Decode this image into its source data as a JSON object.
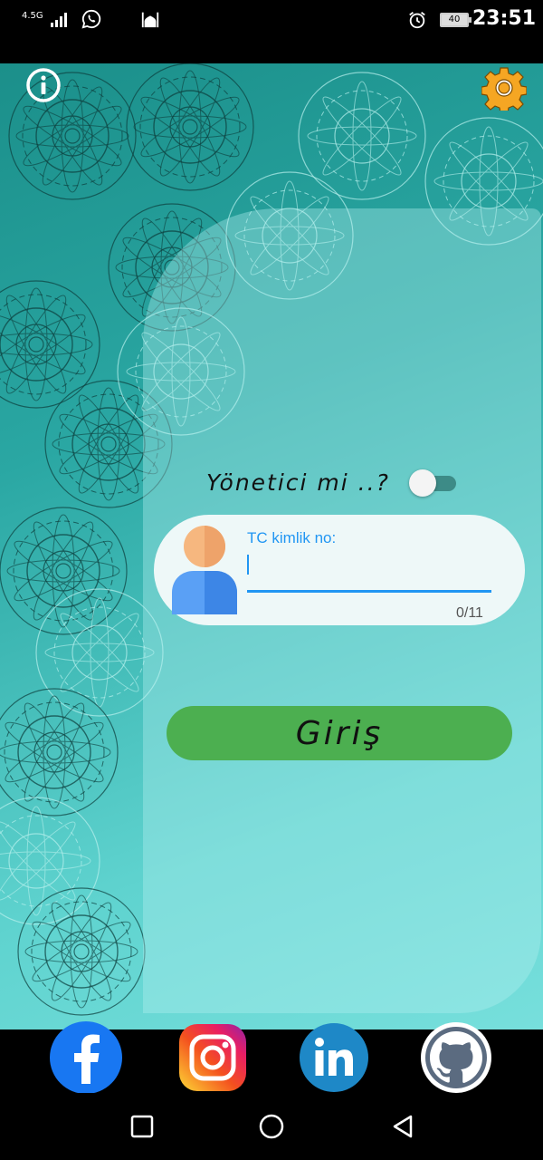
{
  "status_bar": {
    "network": "4.5G",
    "battery": "40",
    "time": "23:51"
  },
  "app": {
    "admin_label": "Yönetici mi ..?",
    "admin_toggle_on": false,
    "tc_label": "TC kimlik no:",
    "tc_value": "",
    "counter": "0/11",
    "login_button": "Giriş"
  },
  "icons": {
    "info": "info-icon",
    "settings": "gear-icon",
    "avatar": "user-avatar-icon"
  },
  "social": [
    "facebook-icon",
    "instagram-icon",
    "linkedin-icon",
    "github-icon"
  ],
  "navigation": [
    "recent-apps-icon",
    "home-icon",
    "back-icon"
  ],
  "colors": {
    "accent": "#2196f3",
    "button": "#4caf50",
    "background": "#2aa7a3",
    "settings_gear": "#f5a623"
  }
}
